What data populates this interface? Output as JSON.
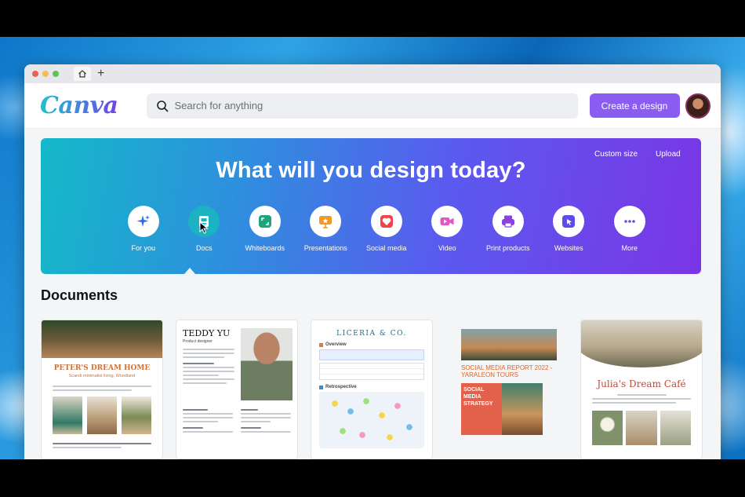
{
  "browser": {
    "home_icon": "home-icon",
    "new_tab_icon": "plus-icon",
    "new_tab_label": "+"
  },
  "header": {
    "logo": "Canva",
    "search_placeholder": "Search for anything",
    "create_label": "Create a design"
  },
  "hero": {
    "title": "What will you design today?",
    "custom_size_label": "Custom size",
    "upload_label": "Upload",
    "categories": [
      {
        "label": "For you",
        "icon": "sparkle-icon",
        "color": "#2d6ee8"
      },
      {
        "label": "Docs",
        "icon": "docs-icon",
        "color": "#ffffff",
        "active": true
      },
      {
        "label": "Whiteboards",
        "icon": "whiteboard-icon",
        "color": "#1aa57a"
      },
      {
        "label": "Presentations",
        "icon": "presentation-icon",
        "color": "#f19a1e"
      },
      {
        "label": "Social media",
        "icon": "heart-icon",
        "color": "#f0434a"
      },
      {
        "label": "Video",
        "icon": "video-icon",
        "color": "#e455c6"
      },
      {
        "label": "Print products",
        "icon": "printer-icon",
        "color": "#8b43df"
      },
      {
        "label": "Websites",
        "icon": "website-icon",
        "color": "#5b4de9"
      },
      {
        "label": "More",
        "icon": "more-icon",
        "color": "#6b4ce0"
      }
    ]
  },
  "documents": {
    "title": "Documents",
    "cards": [
      {
        "title": "PETER'S DREAM HOME",
        "subtitle": "Scandi minimalist living, Woodland"
      },
      {
        "title": "TEDDY YU",
        "subtitle": "Product designer"
      },
      {
        "title": "LICERIA & CO.",
        "subtitle": "Overview",
        "section2": "Retrospective"
      },
      {
        "title": "SOCIAL MEDIA REPORT 2022 - YARALEON TOURS",
        "subtitle": "SOCIAL MEDIA STRATEGY"
      },
      {
        "title": "Julia's Dream Café",
        "subtitle": ""
      }
    ]
  },
  "colors": {
    "brand": "#8b5cf0",
    "hero_start": "#14b9c8",
    "hero_end": "#7b35e6"
  }
}
